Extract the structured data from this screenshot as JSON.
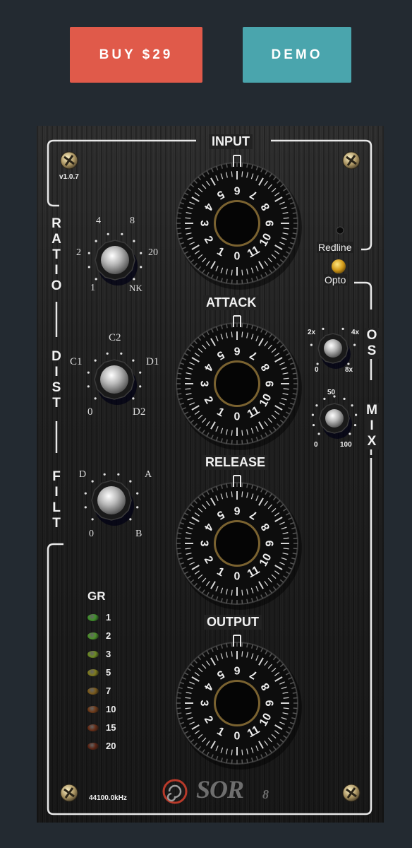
{
  "header": {
    "buy_label": "BUY $29",
    "demo_label": "DEMO",
    "buy_color": "#e05a4a",
    "demo_color": "#4aa5ad"
  },
  "plugin": {
    "version": "v1.0.7",
    "sample_rate": "44100.0kHz",
    "brand": "SOR",
    "brand_suffix": "8",
    "big_knobs": [
      {
        "label": "INPUT"
      },
      {
        "label": "ATTACK"
      },
      {
        "label": "RELEASE"
      },
      {
        "label": "OUTPUT"
      }
    ],
    "dial_scale": [
      "0",
      "1",
      "2",
      "3",
      "4",
      "5",
      "6",
      "7",
      "8",
      "9",
      "10",
      "11"
    ],
    "ratio": {
      "label": "RATIO",
      "marks": [
        "1",
        "2",
        "4",
        "8",
        "20",
        "NK"
      ]
    },
    "dist": {
      "label": "DIST",
      "marks": [
        "0",
        "C1",
        "C2",
        "D1",
        "D2"
      ]
    },
    "filt": {
      "label": "FILT",
      "marks": [
        "0",
        "D",
        "A",
        "B"
      ]
    },
    "redline": "Redline",
    "opto": "Opto",
    "os": {
      "label": "OS",
      "marks": [
        "2x",
        "4x",
        "0",
        "8x"
      ]
    },
    "mix": {
      "label": "MIX",
      "marks": [
        "50",
        "0",
        "100"
      ]
    },
    "gr": {
      "title": "GR",
      "levels": [
        "1",
        "2",
        "3",
        "5",
        "7",
        "10",
        "15",
        "20"
      ],
      "led_colors": [
        "#3f8f2a",
        "#4c8f2a",
        "#6b8a22",
        "#7d7a1e",
        "#7a5a1c",
        "#6e3a18",
        "#642c16",
        "#5a2414"
      ]
    }
  }
}
